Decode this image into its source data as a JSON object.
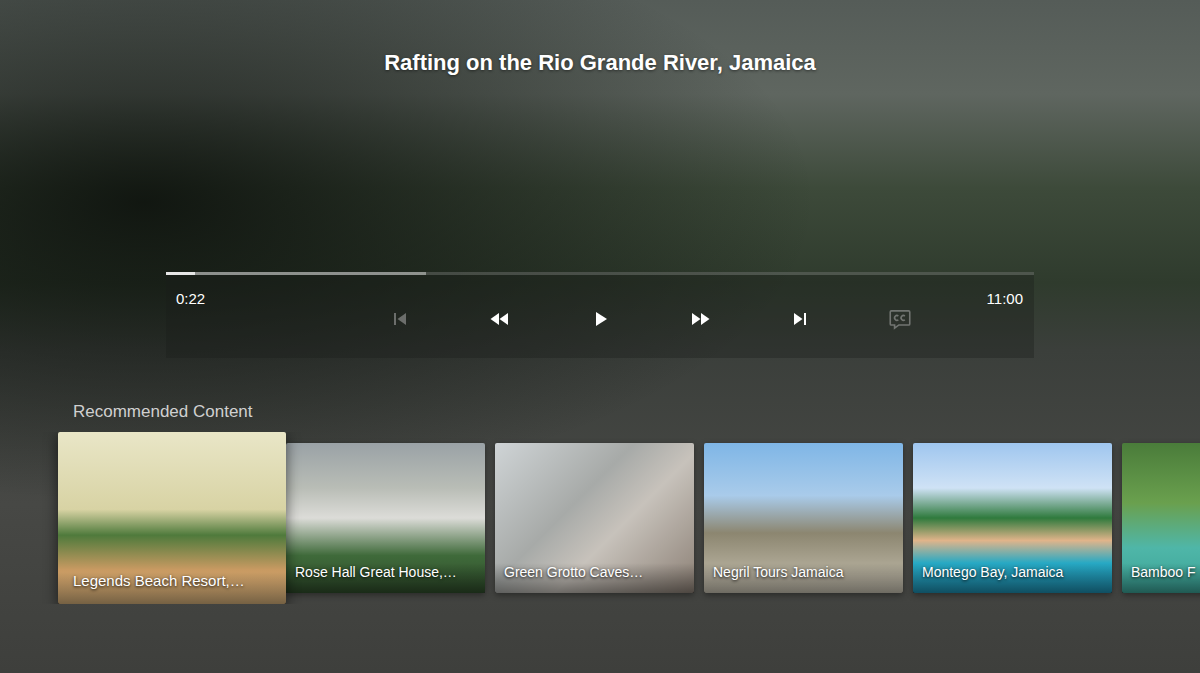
{
  "video": {
    "title": "Rafting on the Rio Grande River, Jamaica"
  },
  "player": {
    "elapsed": "0:22",
    "duration": "11:00",
    "progress": {
      "level": 0.033,
      "buffered": 0.3
    },
    "controls": [
      {
        "kind": "skip-previous",
        "disabled": true
      },
      {
        "kind": "rewind",
        "disabled": false
      },
      {
        "kind": "play",
        "disabled": false
      },
      {
        "kind": "fast-forward",
        "disabled": false
      },
      {
        "kind": "skip-next",
        "disabled": false
      },
      {
        "kind": "closed-captions",
        "disabled": true
      }
    ]
  },
  "recommended": {
    "heading": "Recommended Content",
    "items": [
      {
        "title": "Legends Beach Resort,…",
        "selected": true
      },
      {
        "title": "Rose Hall Great House,…",
        "selected": false
      },
      {
        "title": "Green Grotto Caves…",
        "selected": false
      },
      {
        "title": "Negril Tours Jamaica",
        "selected": false
      },
      {
        "title": "Montego Bay, Jamaica",
        "selected": false
      },
      {
        "title": "Bamboo F",
        "selected": false
      }
    ]
  }
}
